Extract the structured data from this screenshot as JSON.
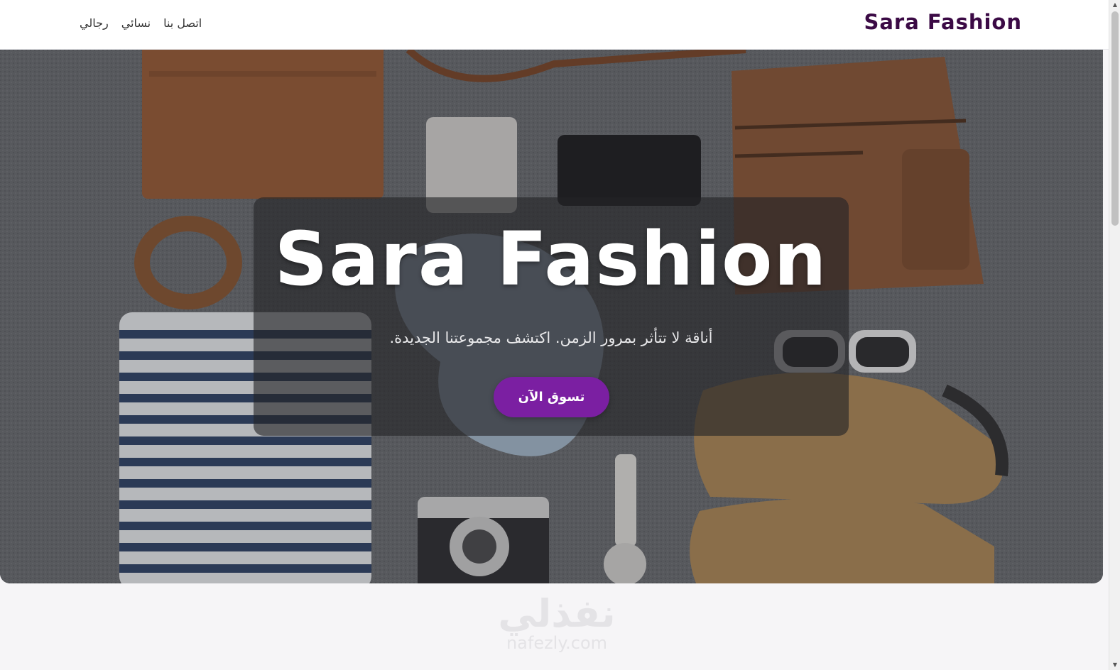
{
  "header": {
    "brand": "Sara Fashion",
    "nav": [
      {
        "label": "رجالي"
      },
      {
        "label": "نسائي"
      },
      {
        "label": "اتصل بنا"
      }
    ]
  },
  "hero": {
    "title": "Sara Fashion",
    "subtitle": "أناقة لا تتأثر بمرور الزمن. اكتشف مجموعتنا الجديدة.",
    "cta_label": "تسوق الآن",
    "cta_color": "#7b1fa2"
  },
  "watermark": {
    "arabic": "نفذلي",
    "latin": "nafezly.com"
  },
  "colors": {
    "brand": "#3b0a45",
    "accent": "#7b1fa2"
  }
}
